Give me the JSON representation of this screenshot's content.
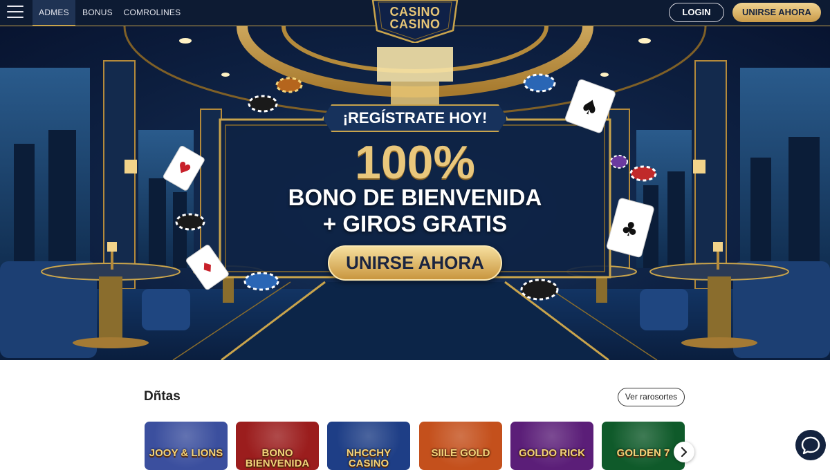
{
  "nav": {
    "links": [
      "ADMES",
      "BONUS",
      "COMROLINES"
    ],
    "active_index": 0,
    "logo_lines": [
      "CASINO",
      "CASINO"
    ],
    "login_label": "LOGIN",
    "join_label": "UNIRSE AHORA"
  },
  "hero": {
    "badge": "¡REGÍSTRATE HOY!",
    "percent": "100%",
    "line1": "BONO DE BIENVENIDA",
    "line2": "+ GIROS GRATIS",
    "cta_label": "UNIRSE AHORA"
  },
  "games": {
    "title": "Dñtas",
    "see_all_label": "Ver rarosortes",
    "tiles": [
      {
        "title": "JOOY & LIONS",
        "bg": "#3b4f9e"
      },
      {
        "title": "BONO BIENVENIDA",
        "bg": "#9b1d1d"
      },
      {
        "title": "NHCCHY CASINO",
        "bg": "#1e3e86"
      },
      {
        "title": "SIILE GOLD",
        "bg": "#c4501c"
      },
      {
        "title": "GOLDO RICK",
        "bg": "#5b1e78"
      },
      {
        "title": "GOLDEN 7",
        "bg": "#0f5a2a"
      }
    ]
  },
  "icons": {
    "menu": "hamburger-icon",
    "next": "chevron-right-icon",
    "chat": "chat-bubble-icon"
  },
  "colors": {
    "nav_bg": "#0d1b33",
    "gold": "#c9a44c",
    "hero_bg": "#0f2447"
  }
}
